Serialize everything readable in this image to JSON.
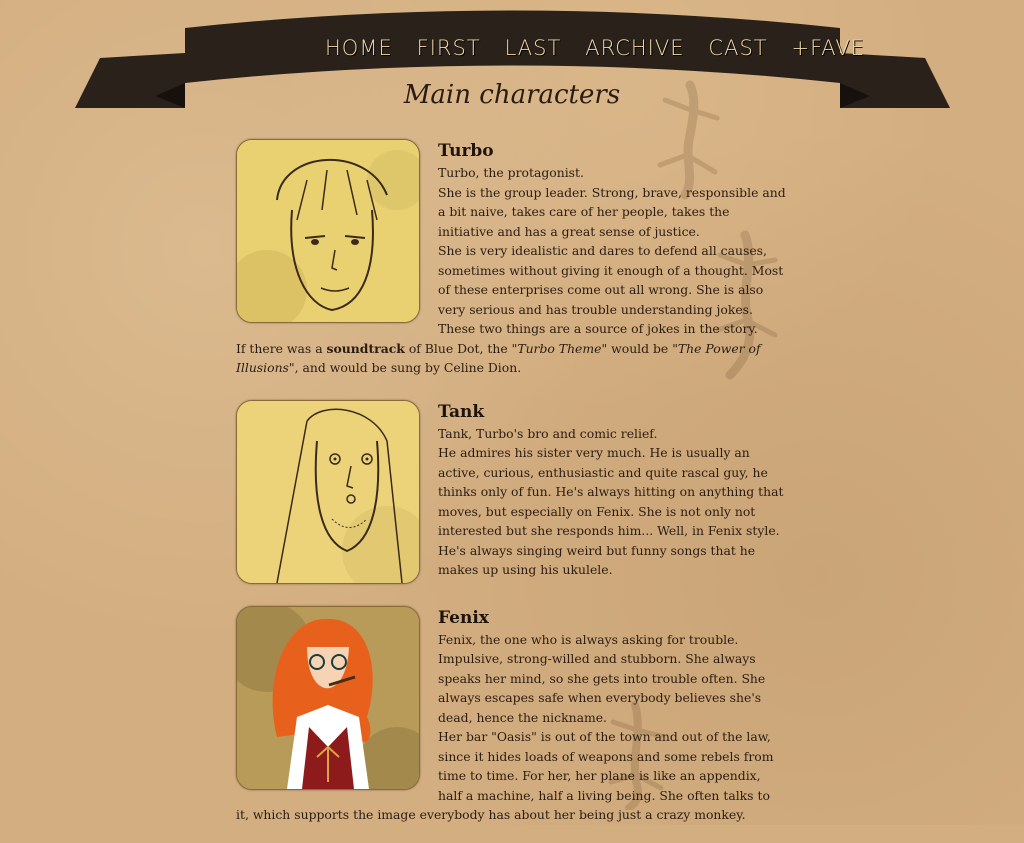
{
  "nav": {
    "items": [
      "HOME",
      "FIRST",
      "LAST",
      "ARCHIVE",
      "CAST",
      "+FAVE"
    ]
  },
  "page_title": "Main characters",
  "characters": [
    {
      "name": "Turbo",
      "lines": [
        "Turbo, the protagonist.",
        "She is the group leader. Strong, brave, responsible and a bit naive, takes care of her people, takes the initiative and has a great sense of justice.",
        "She is very idealistic and dares to defend all causes, sometimes without giving it enough of a thought. Most of these enterprises come out all wrong. She is also very serious and has trouble understanding jokes. These two things are a source of jokes in the story."
      ],
      "soundtrack": {
        "prefix": "If there was a ",
        "bold": "soundtrack",
        "mid1": " of Blue Dot, the \"",
        "theme": "Turbo Theme",
        "mid2": "\" would be \"",
        "song": "The Power of Illusions",
        "suffix": "\", and would be sung by Celine Dion."
      }
    },
    {
      "name": "Tank",
      "lines": [
        "Tank, Turbo's bro and comic relief.",
        "He admires his sister very much. He is usually an active, curious, enthusiastic and quite rascal guy, he thinks only of fun. He's always hitting on anything that moves, but especially on Fenix. She is not only not interested but she responds him... Well, in Fenix style.",
        "He's always singing weird but funny songs that he makes up using his ukulele."
      ]
    },
    {
      "name": "Fenix",
      "lines": [
        "Fenix, the one who is always asking for trouble.",
        "Impulsive, strong-willed and stubborn. She always speaks her mind, so she gets into trouble often. She always escapes safe when everybody believes she's dead, hence the nickname.",
        "Her bar \"Oasis\" is out of the town and out of the law, since it hides loads of weapons and some rebels from time to time. For her, her plane is like an appendix, half a machine, half a living being. She often talks to it, which supports the image everybody has about her being just a crazy monkey."
      ]
    }
  ],
  "colors": {
    "background": "#d3ae80",
    "banner": "#2b211b",
    "nav_text": "#f0d9a8",
    "portrait_bg": "#e8cf76"
  }
}
